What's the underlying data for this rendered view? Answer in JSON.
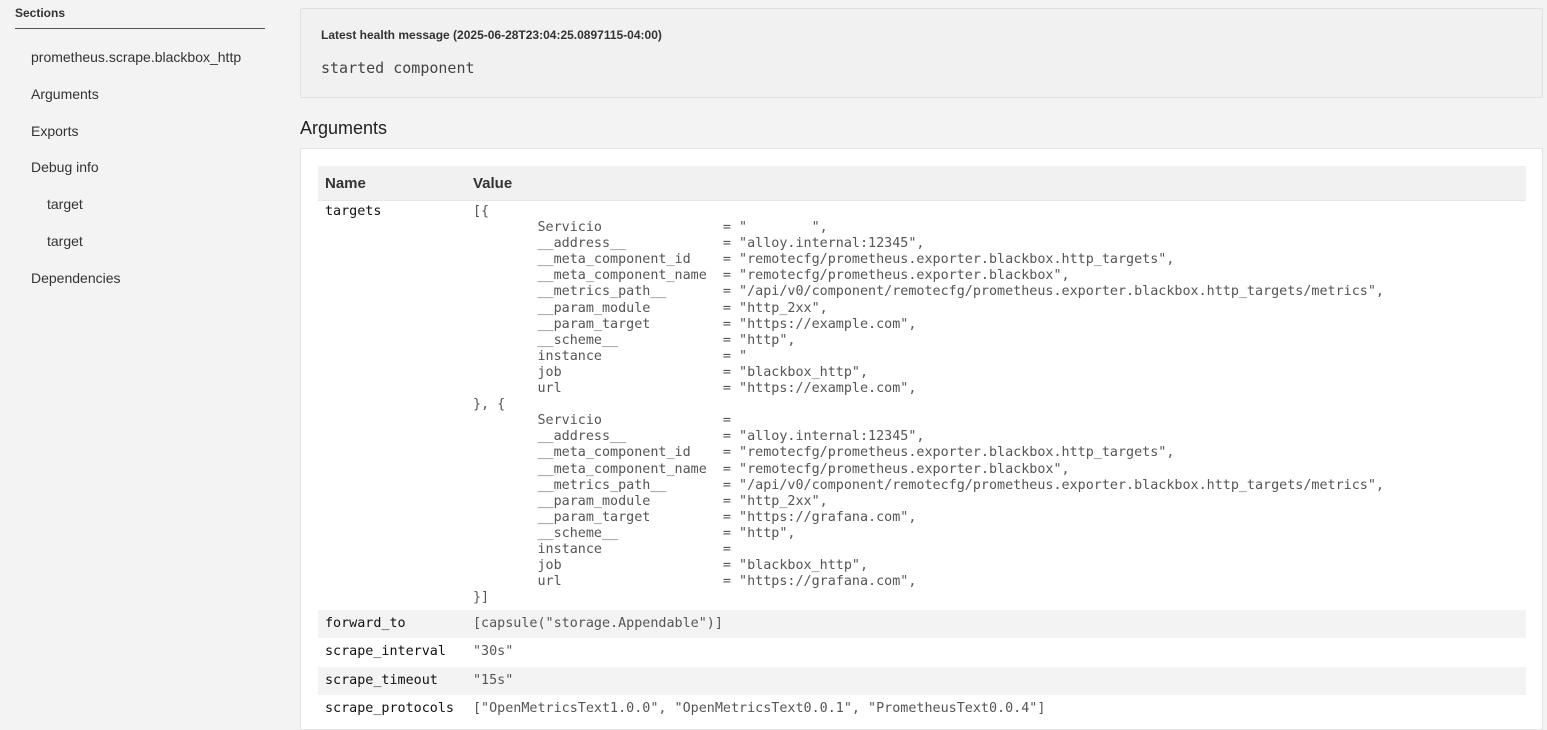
{
  "sidebar": {
    "heading": "Sections",
    "items": [
      {
        "label": "prometheus.scrape.blackbox_http",
        "level": 0
      },
      {
        "label": "Arguments",
        "level": 0
      },
      {
        "label": "Exports",
        "level": 0
      },
      {
        "label": "Debug info",
        "level": 0
      },
      {
        "label": "target",
        "level": 1
      },
      {
        "label": "target",
        "level": 1
      },
      {
        "label": "Dependencies",
        "level": 0
      }
    ]
  },
  "health": {
    "title": "Latest health message (2025-06-28T23:04:25.0897115-04:00)",
    "message": "started component"
  },
  "arguments": {
    "title": "Arguments",
    "columns": {
      "name": "Name",
      "value": "Value"
    },
    "rows": [
      {
        "name": "targets",
        "value": "[{\n        Servicio               = \"        \",\n        __address__            = \"alloy.internal:12345\",\n        __meta_component_id    = \"remotecfg/prometheus.exporter.blackbox.http_targets\",\n        __meta_component_name  = \"remotecfg/prometheus.exporter.blackbox\",\n        __metrics_path__       = \"/api/v0/component/remotecfg/prometheus.exporter.blackbox.http_targets/metrics\",\n        __param_module         = \"http_2xx\",\n        __param_target         = \"https://example.com\",\n        __scheme__             = \"http\",\n        instance               = \"\n        job                    = \"blackbox_http\",\n        url                    = \"https://example.com\",\n}, {\n        Servicio               = \n        __address__            = \"alloy.internal:12345\",\n        __meta_component_id    = \"remotecfg/prometheus.exporter.blackbox.http_targets\",\n        __meta_component_name  = \"remotecfg/prometheus.exporter.blackbox\",\n        __metrics_path__       = \"/api/v0/component/remotecfg/prometheus.exporter.blackbox.http_targets/metrics\",\n        __param_module         = \"http_2xx\",\n        __param_target         = \"https://grafana.com\",\n        __scheme__             = \"http\",\n        instance               = \n        job                    = \"blackbox_http\",\n        url                    = \"https://grafana.com\",\n}]"
      },
      {
        "name": "forward_to",
        "value": "[capsule(\"storage.Appendable\")]"
      },
      {
        "name": "scrape_interval",
        "value": "\"30s\""
      },
      {
        "name": "scrape_timeout",
        "value": "\"15s\""
      },
      {
        "name": "scrape_protocols",
        "value": "[\"OpenMetricsText1.0.0\", \"OpenMetricsText0.0.1\", \"PrometheusText0.0.4\"]"
      }
    ]
  }
}
